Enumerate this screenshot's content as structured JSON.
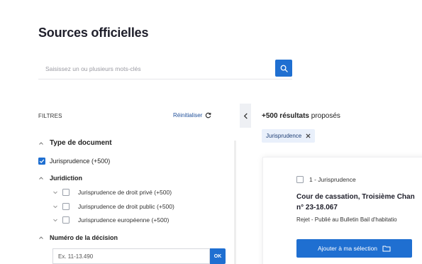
{
  "page": {
    "title": "Sources officielles"
  },
  "search": {
    "placeholder": "Saisissez un ou plusieurs mots-clés",
    "button_icon": "search-icon"
  },
  "filters": {
    "title": "FILTRES",
    "reset_label": "Réinitialiser",
    "reset_icon": "refresh-icon",
    "collapse_icon": "chevron-left-icon",
    "document_type": {
      "label": "Type de document",
      "option": {
        "label": "Jurisprudence (+500)",
        "checked": true
      }
    },
    "juridiction": {
      "label": "Juridiction",
      "options": [
        {
          "label": "Jurisprudence de droit privé (+500)",
          "checked": false
        },
        {
          "label": "Jurisprudence de droit public (+500)",
          "checked": false
        },
        {
          "label": "Jurisprudence européenne (+500)",
          "checked": false
        }
      ]
    },
    "decision_number": {
      "label": "Numéro de la décision",
      "placeholder": "Ex. 11-13.490",
      "ok_label": "OK"
    }
  },
  "results": {
    "count_bold": "+500 résultats",
    "count_rest": " proposés",
    "active_chip": {
      "label": "Jurisprudence",
      "remove_icon": "close-icon"
    },
    "first": {
      "header": "1 - Jurisprudence",
      "title_line1": "Cour de cassation, Troisième Chan",
      "title_line2": "n° 23-18.067",
      "subtitle": "Rejet - Publié au Bulletin Bail d'habitatio",
      "add_label": "Ajouter à ma sélection",
      "add_icon": "folder-icon"
    }
  },
  "colors": {
    "accent": "#1f6fd1",
    "chip_bg": "#e9f0fb"
  }
}
